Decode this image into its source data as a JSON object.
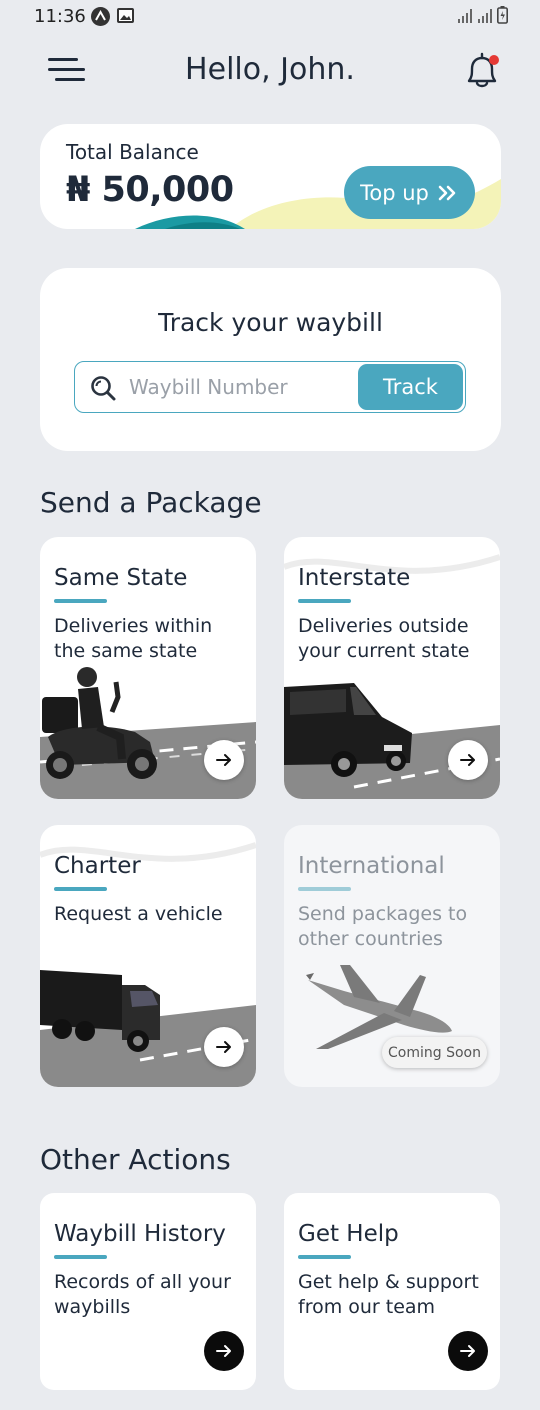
{
  "status_bar": {
    "time": "11:36"
  },
  "header": {
    "greeting": "Hello, John."
  },
  "balance": {
    "label": "Total Balance",
    "amount": "₦ 50,000",
    "topup_label": "Top up"
  },
  "track": {
    "title": "Track your waybill",
    "placeholder": "Waybill Number",
    "button_label": "Track"
  },
  "send_package": {
    "title": "Send a Package",
    "cards": [
      {
        "title": "Same State",
        "description": "Deliveries within the same state"
      },
      {
        "title": "Interstate",
        "description": "Deliveries outside your current state"
      },
      {
        "title": "Charter",
        "description": "Request a vehicle"
      },
      {
        "title": "International",
        "description": "Send packages to other countries",
        "badge": "Coming Soon"
      }
    ]
  },
  "other_actions": {
    "title": "Other Actions",
    "cards": [
      {
        "title": "Waybill History",
        "description": "Records of all your waybills"
      },
      {
        "title": "Get Help",
        "description": "Get help & support from our team"
      }
    ]
  },
  "colors": {
    "accent": "#4aa7bf",
    "background": "#e9ebef",
    "text": "#1f2a3a",
    "notification_dot": "#e53935"
  }
}
